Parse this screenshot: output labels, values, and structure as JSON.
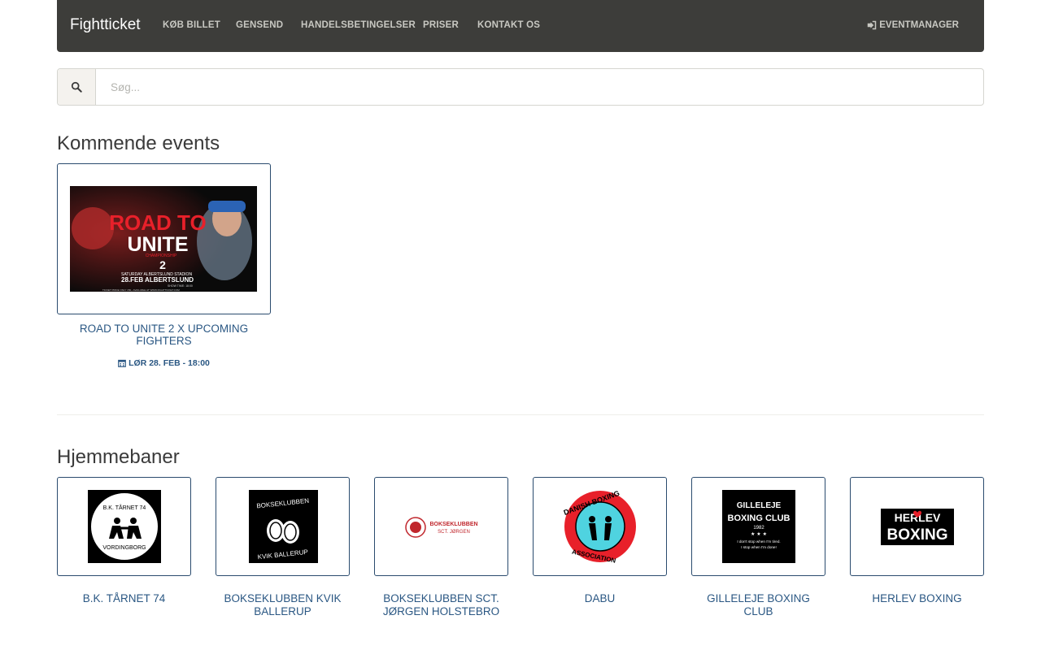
{
  "navbar": {
    "brand": "Fightticket",
    "items": [
      {
        "label": "Køb billet"
      },
      {
        "label": "Gensend"
      },
      {
        "label": "Handelsbetingelser"
      },
      {
        "label": "Priser"
      },
      {
        "label": "Kontakt os"
      }
    ],
    "right_label": "Eventmanager",
    "right_icon": "sign-in-icon",
    "bg_color": "#3d3d3a"
  },
  "search": {
    "placeholder": "Søg...",
    "value": "",
    "icon": "search-icon"
  },
  "upcoming": {
    "heading": "Kommende events",
    "events": [
      {
        "poster": {
          "headline_1": "ROAD TO",
          "headline_2": "UNITE",
          "sub": "CHAMPIONSHIP",
          "number": "2",
          "line_1": "SATURDAY ALBERTSLUND STADION",
          "line_2": "28.FEB ALBERTSLUND",
          "line_3": "SHOW TIME: 18:00",
          "line_4": "TICKET PRICE ONLY 150,- AVAILABLE AT WWW.FIGHTTICKET.COM"
        },
        "title": "Road to Unite 2 x Upcoming fighters",
        "date": "Lør 28. feb - 18:00",
        "date_icon": "calendar-icon"
      }
    ]
  },
  "home": {
    "heading": "Hjemmebaner",
    "clubs": [
      {
        "name": "B.K. Tårnet 74",
        "logo_top": "B.K. TÅRNET 74",
        "logo_bottom": "VORDINGBORG"
      },
      {
        "name": "Bokseklubben Kvik Ballerup",
        "logo_top": "BOKSEKLUBBEN",
        "logo_bottom": "KVIK BALLERUP"
      },
      {
        "name": "Bokseklubben Sct. Jørgen Holstebro",
        "logo_top": "BOKSEKLUBBEN",
        "logo_bottom": "SCT. JØRGEN"
      },
      {
        "name": "DABU",
        "logo_top": "DANISH BOXING",
        "logo_bottom": "ASSOCIATION"
      },
      {
        "name": "Gilleleje Boxing Club",
        "logo_top": "GILLELEJE",
        "logo_mid": "BOXING CLUB",
        "logo_year": "1982",
        "logo_line_1": "I don't stop when I'm tired.",
        "logo_line_2": "I stop when I'm done!"
      },
      {
        "name": "Herlev Boxing",
        "logo_top": "HERLEV",
        "logo_bottom": "BOXING"
      }
    ]
  },
  "colors": {
    "link": "#2a5783",
    "card_border": "#2a4b6e",
    "poster_red": "#e8202a"
  }
}
